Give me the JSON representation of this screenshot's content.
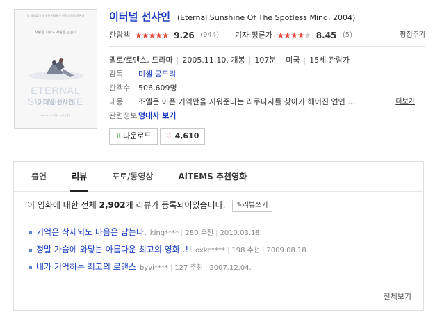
{
  "poster": {
    "tagline": "이 영화를 보지 못한 사람들은 아직 사랑을 모른다",
    "subtitle": "사랑은 지워도 사랑은 남는다",
    "english_title": "ETERNAL SUNSHINE",
    "korean_title": "이터널 선샤인",
    "credits": "2005.11.10 개봉 · 15세 관람가"
  },
  "movie": {
    "title_ko": "이터널 선샤인",
    "title_en": "(Eternal Sunshine Of The Spotless Mind, 2004)"
  },
  "ratings": {
    "audience_label": "관람객",
    "audience_score": "9.26",
    "audience_count": "(944)",
    "audience_stars": 4.63,
    "critic_label": "기자·평론가",
    "critic_score": "8.45",
    "critic_count": "(5)",
    "critic_stars": 4.2,
    "policy_label": "평점주기"
  },
  "meta": {
    "genre": "멜로/로맨스, 드라마",
    "release": "2005.11.10. 개봉",
    "runtime": "107분",
    "country": "미국",
    "age": "15세 관람가",
    "director_label": "감독",
    "director": "미셸 공드리",
    "audience_count_label": "관객수",
    "audience_total": "506,609명",
    "plot_label": "내용",
    "plot": "조엘은 아픈 기억만을 지워준다는 라쿠나사를 찾아가 헤어진 연인 ...",
    "more_label": "더보기",
    "related_label": "관련정보",
    "related_link": "명대사 보기"
  },
  "actions": {
    "download_label": "다운로드",
    "like_count": "4,610"
  },
  "tabs": [
    {
      "label": "출연"
    },
    {
      "label": "리뷰"
    },
    {
      "label": "포토/동영상"
    },
    {
      "label": "AiTEMS 추천영화"
    }
  ],
  "reviews": {
    "summary_prefix": "이 영화에 대한 전체",
    "summary_count": "2,902",
    "summary_suffix": "개 리뷰가 등록되어있습니다.",
    "write_label": "리뷰쓰기",
    "items": [
      {
        "title": "기억은 삭제되도 마음은 남는다.",
        "user": "king****",
        "recommend": "280 추천",
        "date": "2010.03.18."
      },
      {
        "title": "정말 가슴에 와닿는 아름다운 최고의 영화..!!",
        "user": "oxkc****",
        "recommend": "198 추천",
        "date": "2009.08.18."
      },
      {
        "title": "내가 기억하는 최고의 로맨스",
        "user": "byvi****",
        "recommend": "127 추천",
        "date": "2007.12.04."
      }
    ],
    "view_all": "전체보기"
  },
  "colors": {
    "accent": "#1a3dc1",
    "star": "#e84a3a",
    "download_icon": "#3aa34a"
  }
}
